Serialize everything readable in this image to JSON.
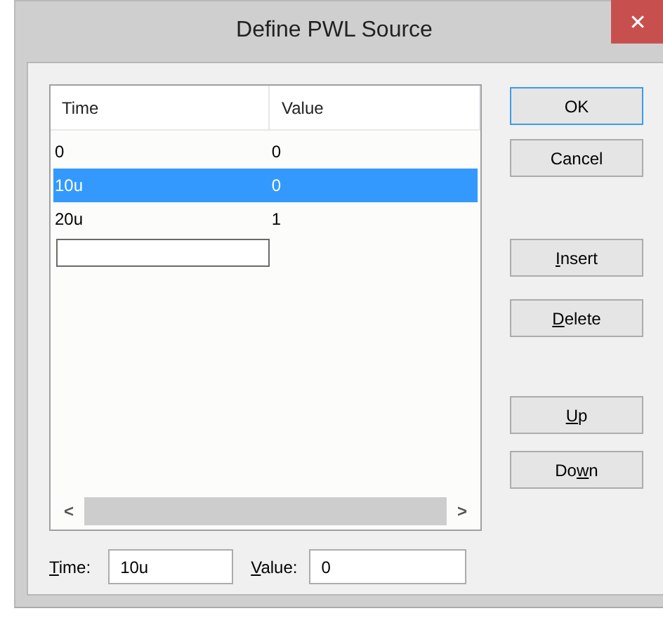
{
  "window": {
    "title": "Define PWL Source",
    "close": "✕"
  },
  "table": {
    "columns": [
      "Time",
      "Value"
    ],
    "rows": [
      {
        "cells": [
          "0",
          "0"
        ],
        "selected": false
      },
      {
        "cells": [
          "10u",
          "0"
        ],
        "selected": true
      },
      {
        "cells": [
          "20u",
          "1"
        ],
        "selected": false
      }
    ],
    "scroll_left": "<",
    "scroll_right": ">"
  },
  "buttons": [
    {
      "after": "OK",
      "default": true
    },
    {
      "after": "Cancel",
      "default": false
    },
    {
      "key": "I",
      "after": "nsert",
      "default": false
    },
    {
      "key": "D",
      "after": "elete",
      "default": false
    },
    {
      "key": "U",
      "after": "p",
      "default": false
    },
    {
      "before": "Do",
      "key": "w",
      "after": "n",
      "default": false
    }
  ],
  "fields": [
    {
      "key": "T",
      "after": "ime:",
      "value": "10u"
    },
    {
      "key": "V",
      "after": "alue:",
      "value": "0"
    }
  ]
}
